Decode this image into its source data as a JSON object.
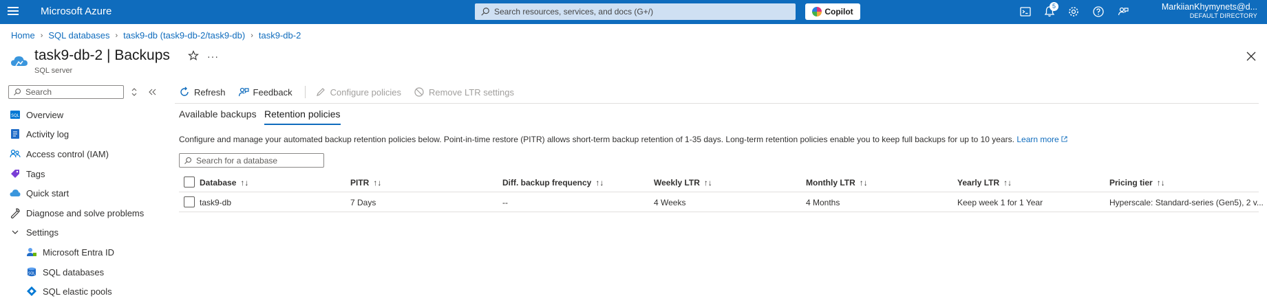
{
  "topbar": {
    "brand": "Microsoft Azure",
    "search_placeholder": "Search resources, services, and docs (G+/)",
    "copilot_label": "Copilot",
    "notification_count": "5",
    "user_name": "MarkiianKhymynets@d...",
    "user_directory": "DEFAULT DIRECTORY"
  },
  "breadcrumb": {
    "items": [
      "Home",
      "SQL databases",
      "task9-db (task9-db-2/task9-db)",
      "task9-db-2"
    ]
  },
  "header": {
    "title": "task9-db-2 | Backups",
    "subtitle": "SQL server",
    "more": "···"
  },
  "sidebar": {
    "search_placeholder": "Search",
    "items": [
      {
        "label": "Overview",
        "icon": "sql-server-icon"
      },
      {
        "label": "Activity log",
        "icon": "activity-log-icon"
      },
      {
        "label": "Access control (IAM)",
        "icon": "people-icon"
      },
      {
        "label": "Tags",
        "icon": "tag-icon"
      },
      {
        "label": "Quick start",
        "icon": "cloud-icon"
      },
      {
        "label": "Diagnose and solve problems",
        "icon": "wrench-icon"
      },
      {
        "label": "Settings",
        "icon": "chevron-down-icon"
      },
      {
        "label": "Microsoft Entra ID",
        "icon": "entra-id-icon"
      },
      {
        "label": "SQL databases",
        "icon": "sql-database-icon"
      },
      {
        "label": "SQL elastic pools",
        "icon": "elastic-pool-icon"
      }
    ]
  },
  "toolbar": {
    "refresh": "Refresh",
    "feedback": "Feedback",
    "configure": "Configure policies",
    "remove_ltr": "Remove LTR settings"
  },
  "tabs": {
    "available": "Available backups",
    "retention": "Retention policies",
    "active": "retention"
  },
  "description": {
    "text": "Configure and manage your automated backup retention policies below. Point-in-time restore (PITR) allows short-term backup retention of 1-35 days. Long-term retention policies enable you to keep full backups for up to 10 years.",
    "link": "Learn more"
  },
  "db_search_placeholder": "Search for a database",
  "table": {
    "columns": [
      "Database",
      "PITR",
      "Diff. backup frequency",
      "Weekly LTR",
      "Monthly LTR",
      "Yearly LTR",
      "Pricing tier"
    ],
    "sort_glyph": "↑↓",
    "rows": [
      {
        "database": "task9-db",
        "pitr": "7 Days",
        "diff": "--",
        "weekly": "4 Weeks",
        "monthly": "4 Months",
        "yearly": "Keep week 1 for 1 Year",
        "pricing": "Hyperscale: Standard-series (Gen5), 2 v..."
      }
    ]
  },
  "colors": {
    "topbar": "#0f6cbd",
    "link": "#0f6cbd",
    "text": "#323130"
  }
}
